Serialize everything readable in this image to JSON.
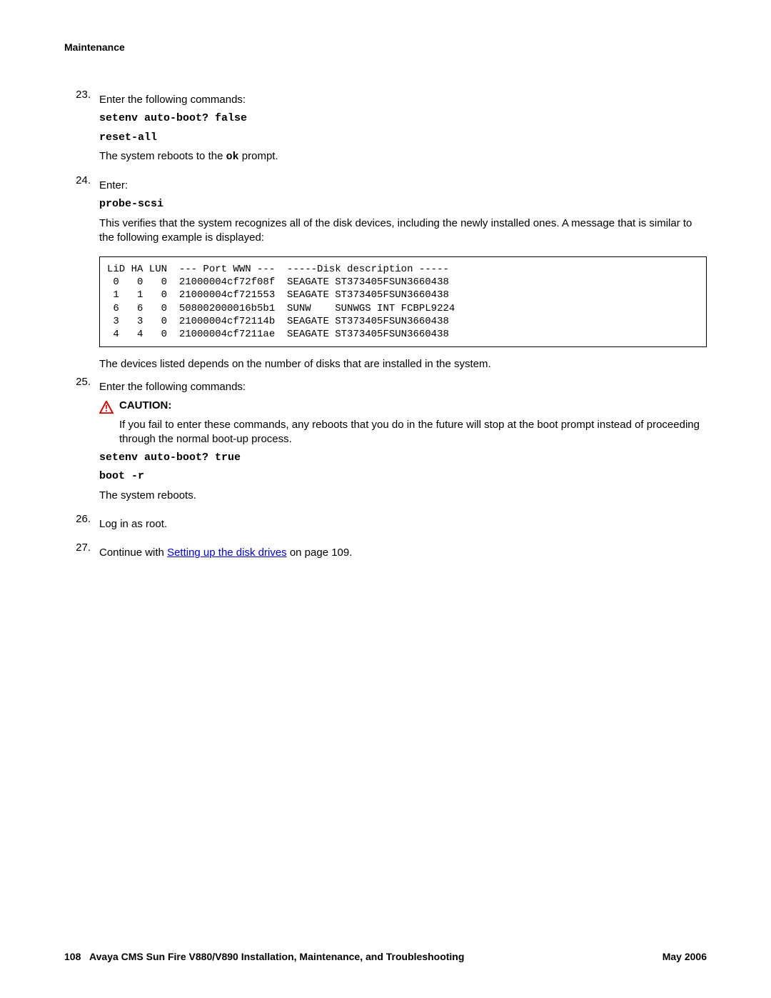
{
  "header": "Maintenance",
  "steps": {
    "s23": {
      "num": "23.",
      "intro": "Enter the following commands:",
      "cmd1": "setenv auto-boot? false",
      "cmd2": "reset-all",
      "after_pre": "The system reboots to the ",
      "after_mono": "ok",
      "after_post": " prompt."
    },
    "s24": {
      "num": "24.",
      "intro": "Enter:",
      "cmd1": "probe-scsi",
      "after": "This verifies that the system recognizes all of the disk devices, including the newly installed ones. A message that is similar to the following example is displayed:"
    },
    "codeblock": "LiD HA LUN  --- Port WWN ---  -----Disk description -----\n 0   0   0  21000004cf72f08f  SEAGATE ST373405FSUN3660438\n 1   1   0  21000004cf721553  SEAGATE ST373405FSUN3660438\n 6   6   0  508002000016b5b1  SUNW    SUNWGS INT FCBPL9224\n 3   3   0  21000004cf72114b  SEAGATE ST373405FSUN3660438\n 4   4   0  21000004cf7211ae  SEAGATE ST373405FSUN3660438",
    "after_code": "The devices listed depends on the number of disks that are installed in the system.",
    "s25": {
      "num": "25.",
      "intro": "Enter the following commands:",
      "caution_label": "CAUTION:",
      "caution_text": "If you fail to enter these commands, any reboots that you do in the future will stop at the boot prompt instead of proceeding through the normal boot-up process.",
      "cmd1": "setenv auto-boot? true",
      "cmd2": "boot -r",
      "after": "The system reboots."
    },
    "s26": {
      "num": "26.",
      "text": "Log in as root."
    },
    "s27": {
      "num": "27.",
      "pre": "Continue with ",
      "link": "Setting up the disk drives",
      "post": " on page 109."
    }
  },
  "footer": {
    "page": "108",
    "title": "Avaya CMS Sun Fire V880/V890 Installation, Maintenance, and Troubleshooting",
    "date": "May 2006"
  }
}
